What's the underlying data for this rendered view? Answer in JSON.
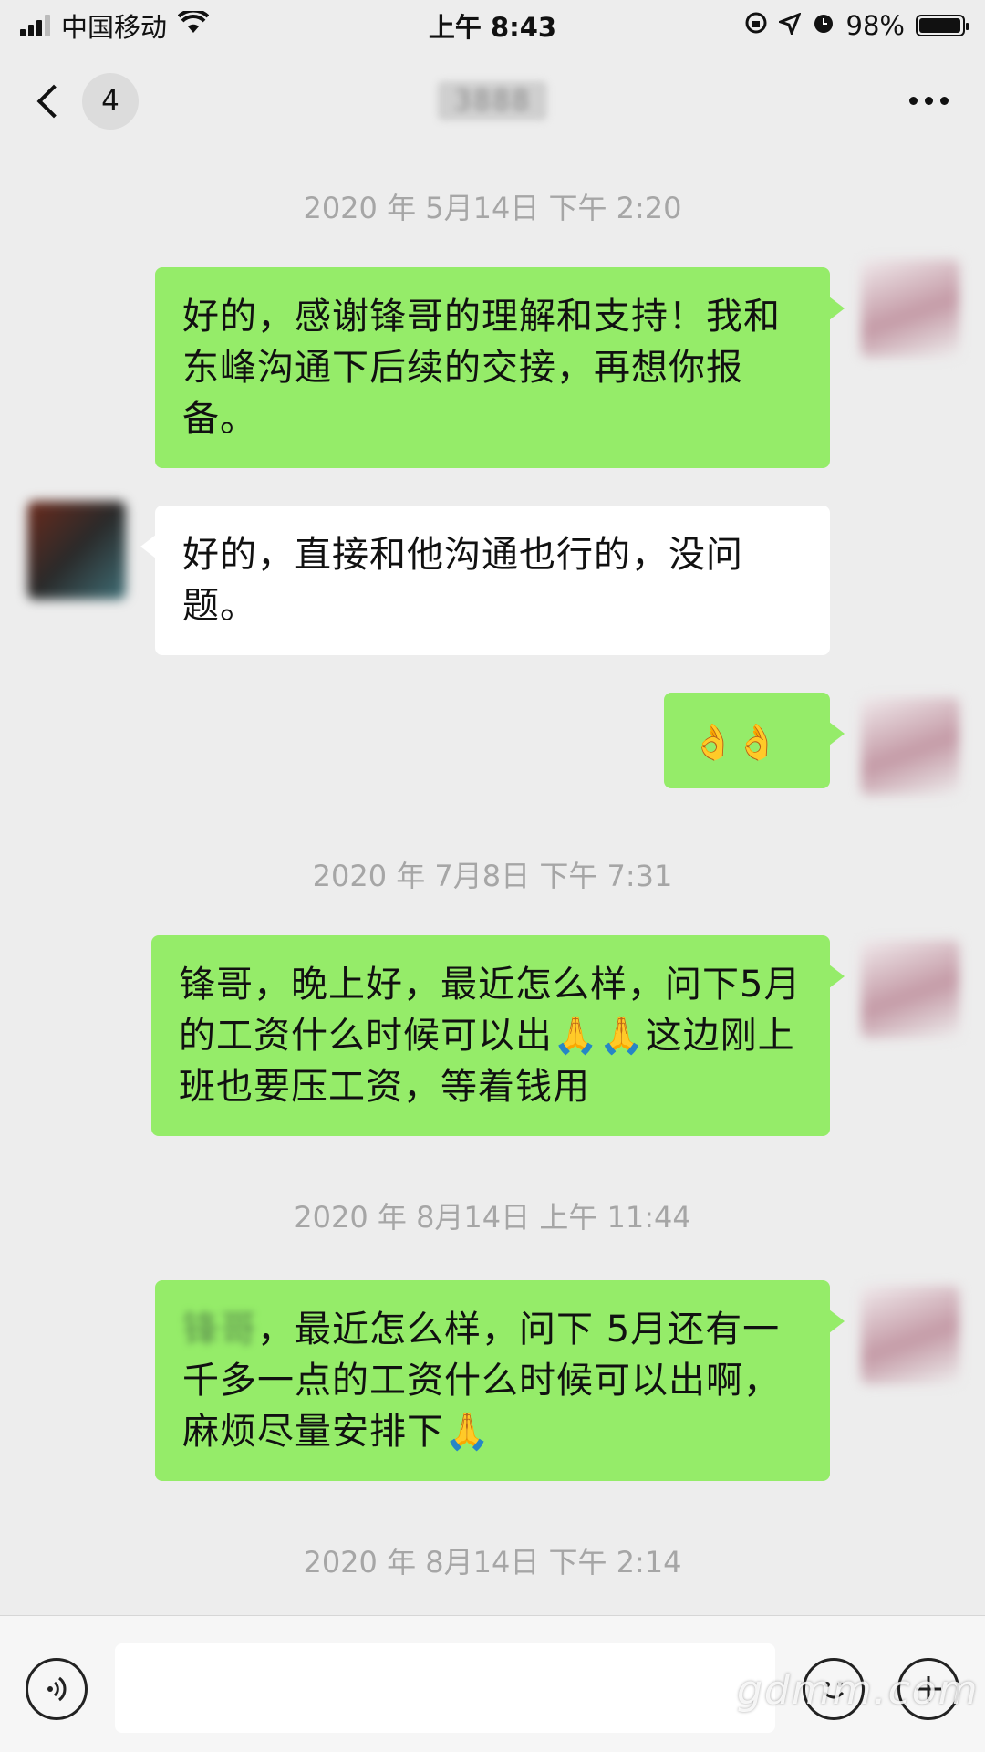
{
  "status_bar": {
    "carrier": "中国移动",
    "time": "上午 8:43",
    "battery": "98%",
    "battery_level": 0.98
  },
  "nav": {
    "unread_count": "4",
    "title_visible_fragment": "3888"
  },
  "chat": {
    "timestamps": [
      "2020 年 5月14日 下午 2:20",
      "2020 年 7月8日 下午 7:31",
      "2020 年 8月14日 上午 11:44",
      "2020 年 8月14日 下午 2:14"
    ],
    "messages": [
      {
        "side": "sent",
        "text": "好的，感谢锋哥的理解和支持！我和东峰沟通下后续的交接，再想你报备。"
      },
      {
        "side": "received",
        "text": "好的，直接和他沟通也行的，没问题。"
      },
      {
        "side": "sent",
        "text": "👌👌"
      },
      {
        "side": "sent",
        "text": "锋哥，晚上好，最近怎么样，问下5月的工资什么时候可以出🙏🙏这边刚上班也要压工资，等着钱用"
      },
      {
        "side": "sent",
        "name_blurred": "锋哥",
        "text": "，最近怎么样，问下 5月还有一千多一点的工资什么时候可以出啊，麻烦尽量安排下🙏"
      }
    ]
  },
  "input_bar": {
    "voice_icon": "voice-icon",
    "emoji_icon": "emoji-icon",
    "plus_icon": "plus-icon",
    "value": ""
  },
  "watermark": "gdmm.com"
}
